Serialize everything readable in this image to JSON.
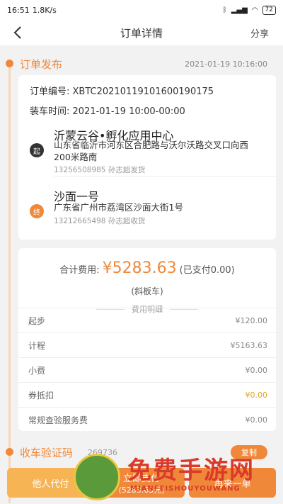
{
  "status_bar": {
    "time": "16:51",
    "speed": "1.8K/s",
    "battery": "72"
  },
  "navbar": {
    "title": "订单详情",
    "share": "分享"
  },
  "order_section": {
    "title": "订单发布",
    "time": "2021-01-19 10:16:00",
    "order_no_label": "订单编号:",
    "order_no": "XBTC20210119101600190175",
    "load_time_label": "装车时间:",
    "load_time": "2021-01-19 10:00-00:00"
  },
  "origin": {
    "badge": "起",
    "name": "沂蒙云谷•孵化应用中心",
    "address": "山东省临沂市河东区合肥路与沃尔沃路交叉口向西200米路南",
    "contact": "13256508985  孙志超发货"
  },
  "destination": {
    "badge": "终",
    "name": "沙面一号",
    "address": "广东省广州市荔湾区沙面大街1号",
    "contact": "13212665498  孙志超收货"
  },
  "fees": {
    "total_label": "合计费用:",
    "total_amount": "¥5283.63",
    "paid_note": "(已支付0.00)",
    "vehicle": "(斜板车)",
    "detail_header": "费用明细",
    "rows": [
      {
        "label": "起步",
        "value": "¥120.00"
      },
      {
        "label": "计程",
        "value": "¥5163.63"
      },
      {
        "label": "小费",
        "value": "¥0.00"
      },
      {
        "label": "券抵扣",
        "value": "¥0.00"
      },
      {
        "label": "常规查验服务费",
        "value": "¥0.00"
      }
    ]
  },
  "verify_section": {
    "title": "收车验证码",
    "code": "269736",
    "copy_label": "复制"
  },
  "bottom_bar": {
    "pay_for_other": "他人代付",
    "pay_now": "立即支付",
    "pay_now_amount": "(5283.63元)",
    "reorder": "再来一单"
  },
  "watermark": {
    "title": "免费手游网",
    "subtitle": "MIANFEISHOUYOUWANG"
  },
  "colors": {
    "accent": "#f0883a",
    "accent_light": "#f6b455",
    "discount": "#e8a21a"
  }
}
